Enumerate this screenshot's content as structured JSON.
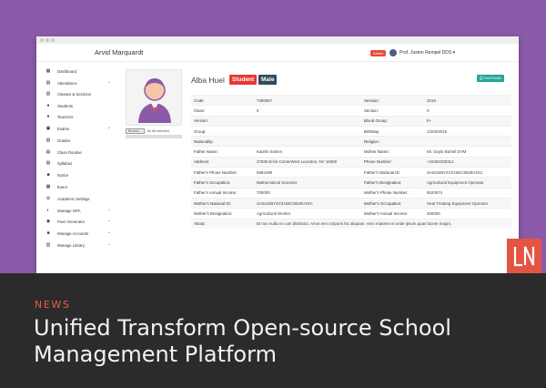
{
  "app": {
    "name": "Arvid Marquardt",
    "role_badge": "Admin",
    "user_name": "Prof. Juston Rempel DDS ▾"
  },
  "sidebar": {
    "items": [
      {
        "label": "Dashboard",
        "icon": "dashboard-icon",
        "chevron": false
      },
      {
        "label": "Attendance",
        "icon": "calendar-icon",
        "chevron": true
      },
      {
        "label": "Classes & Sections",
        "icon": "classes-icon",
        "chevron": false
      },
      {
        "label": "Students",
        "icon": "student-icon",
        "chevron": false
      },
      {
        "label": "Teachers",
        "icon": "teacher-icon",
        "chevron": false
      },
      {
        "label": "Exams",
        "icon": "exam-icon",
        "chevron": true
      },
      {
        "label": "Grades",
        "icon": "grades-icon",
        "chevron": false
      },
      {
        "label": "Class Routine",
        "icon": "routine-icon",
        "chevron": false
      },
      {
        "label": "Syllabus",
        "icon": "syllabus-icon",
        "chevron": false
      },
      {
        "label": "Notice",
        "icon": "notice-icon",
        "chevron": false
      },
      {
        "label": "Event",
        "icon": "event-icon",
        "chevron": false
      },
      {
        "label": "Academic Settings",
        "icon": "settings-icon",
        "chevron": false
      },
      {
        "label": "Manage GPA",
        "icon": "gpa-icon",
        "chevron": true
      },
      {
        "label": "Fees Generator",
        "icon": "fees-icon",
        "chevron": true
      },
      {
        "label": "Manage Accounts",
        "icon": "accounts-icon",
        "chevron": true
      },
      {
        "label": "Manage Library",
        "icon": "library-icon",
        "chevron": true
      }
    ]
  },
  "upload": {
    "browse_label": "Browse...",
    "status": "No file selected."
  },
  "profile": {
    "name": "Alba Huel",
    "role": "Student",
    "gender": "Male",
    "print_label": "Print Profile"
  },
  "info_rows": [
    [
      "Code:",
      "7386957",
      "Session:",
      "2018"
    ],
    [
      "Class:",
      "6",
      "Section:",
      "K"
    ],
    [
      "Version:",
      "",
      "Blood Group:",
      "b+"
    ],
    [
      "Group:",
      "",
      "Birthday:",
      "12/03/2019"
    ],
    [
      "Nationality:",
      "",
      "Religion:",
      ""
    ],
    [
      "Father Name:",
      "Katelin Stokes",
      "Mother Name:",
      "Mr. Doyle Bartell DVM"
    ],
    [
      "Address:",
      "27595 Erick CenterWest Leoraton, NV 16908",
      "Phone Number:",
      "+19402330312"
    ],
    [
      "Father's Phone Number:",
      "5994499",
      "Father's National ID:",
      "SA02188YZVZJSEC8536V4XC"
    ],
    [
      "Father's Occupation:",
      "Mathematical Scientist",
      "Father's Designation:",
      "Agricultural Equipment Operator"
    ],
    [
      "Father's Annual Income:",
      "700000",
      "Mother's Phone Number:",
      "8520574"
    ],
    [
      "Mother's National ID:",
      "SA02188YZVZJSEC8536V4XC",
      "Mother's Occupation:",
      "Heat Treating Equipment Operator"
    ],
    [
      "Mother's Designation:",
      "Agricultural Worker",
      "Mother's Annual Income:",
      "300000"
    ],
    [
      "About:",
      "Et non nulla ex cum distinctio. Amet rem corporis hic aliquam. Vero maiores et unde ipsum quas facere magni.",
      "",
      ""
    ]
  ],
  "news": {
    "label": "NEWS",
    "title": "Unified Transform Open-source School Management Platform"
  },
  "colors": {
    "hero_purple": "#8a5aa8",
    "student_badge": "#e53935",
    "male_badge": "#344a5e",
    "print_button": "#26a69a",
    "news_accent": "#ef5a45",
    "footer_bg": "#2b2b2b",
    "logo_bg": "#e45442"
  }
}
